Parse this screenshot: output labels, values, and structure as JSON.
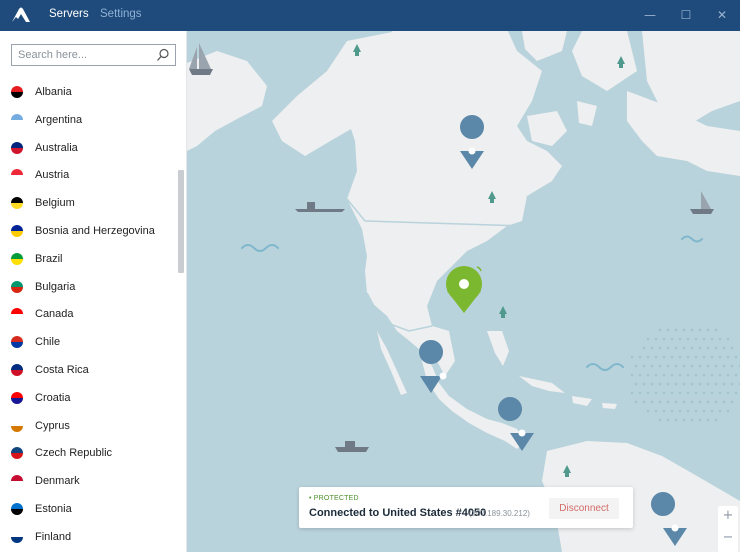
{
  "titlebar": {
    "tabs": [
      {
        "label": "Servers"
      },
      {
        "label": "Settings"
      }
    ],
    "window_controls": {
      "minimize": "—",
      "maximize": "☐",
      "close": "✕"
    }
  },
  "sidebar": {
    "search": {
      "placeholder": "Search here...",
      "value": ""
    },
    "countries": [
      {
        "name": "Albania",
        "flag": [
          "#e41e20",
          "#000000"
        ]
      },
      {
        "name": "Argentina",
        "flag": [
          "#74acdf",
          "#ffffff"
        ]
      },
      {
        "name": "Australia",
        "flag": [
          "#00247d",
          "#cf142b"
        ]
      },
      {
        "name": "Austria",
        "flag": [
          "#ed2939",
          "#ffffff"
        ]
      },
      {
        "name": "Belgium",
        "flag": [
          "#000000",
          "#fdda24"
        ]
      },
      {
        "name": "Bosnia and Herzegovina",
        "flag": [
          "#002395",
          "#fecb00"
        ]
      },
      {
        "name": "Brazil",
        "flag": [
          "#009c3b",
          "#ffdf00"
        ]
      },
      {
        "name": "Bulgaria",
        "flag": [
          "#00966e",
          "#d62612"
        ]
      },
      {
        "name": "Canada",
        "flag": [
          "#ff0000",
          "#ffffff"
        ]
      },
      {
        "name": "Chile",
        "flag": [
          "#d52b1e",
          "#0039a6"
        ]
      },
      {
        "name": "Costa Rica",
        "flag": [
          "#002b7f",
          "#ce1126"
        ]
      },
      {
        "name": "Croatia",
        "flag": [
          "#ff0000",
          "#171796"
        ]
      },
      {
        "name": "Cyprus",
        "flag": [
          "#ffffff",
          "#d57800"
        ]
      },
      {
        "name": "Czech Republic",
        "flag": [
          "#11457e",
          "#d7141a"
        ]
      },
      {
        "name": "Denmark",
        "flag": [
          "#c60c30",
          "#ffffff"
        ]
      },
      {
        "name": "Estonia",
        "flag": [
          "#0072ce",
          "#000000"
        ]
      },
      {
        "name": "Finland",
        "flag": [
          "#ffffff",
          "#003580"
        ]
      }
    ]
  },
  "status": {
    "label": "• PROTECTED",
    "connected_text": "Connected to United States #4050",
    "ip": "(207.189.30.212)",
    "disconnect_label": "Disconnect",
    "color": "#4c8f2a"
  },
  "map": {
    "land_color": "#eeeff0",
    "sea_color": "#b9d3dc",
    "pin_color": "#5b87a8",
    "active_pin_color": "#7cb82f"
  },
  "zoom": {
    "in": "+",
    "out": "−"
  }
}
